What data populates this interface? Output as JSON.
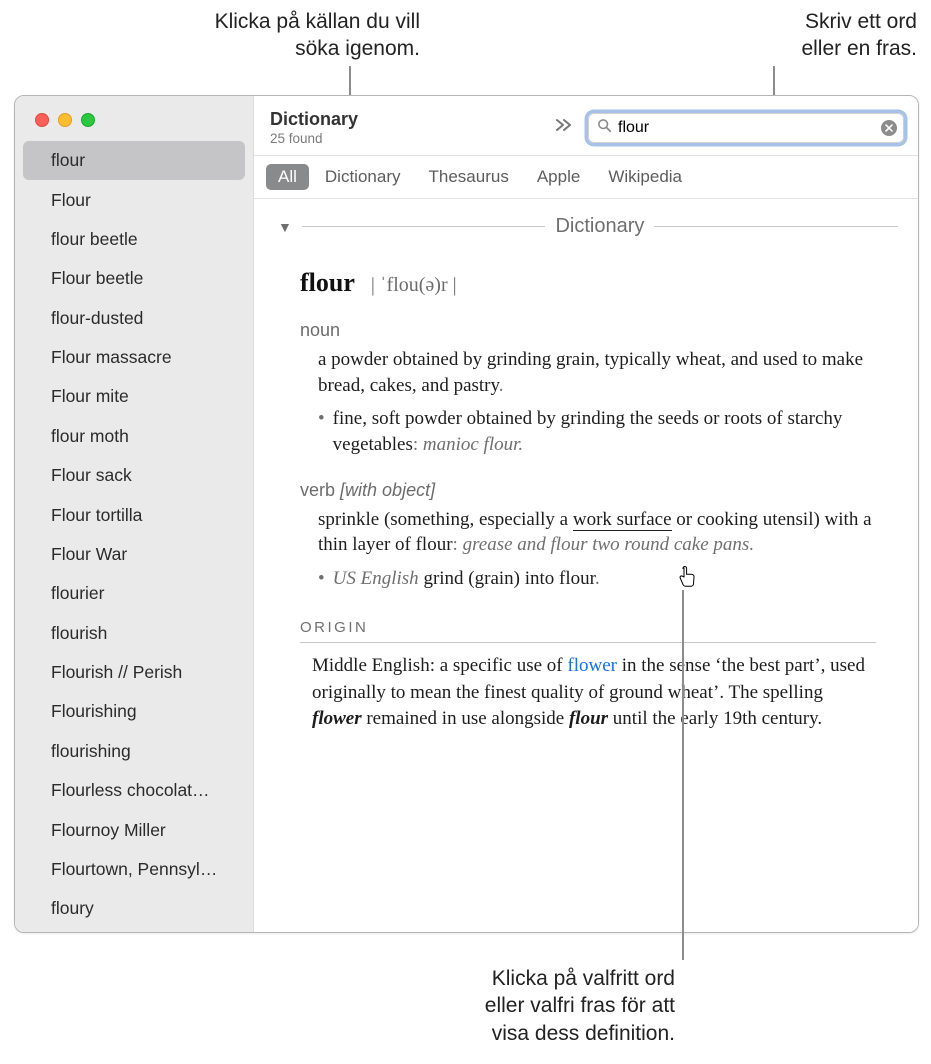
{
  "callouts": {
    "top_left": "Klicka på källan du vill söka igenom.",
    "top_left_1": "Klicka på källan du vill",
    "top_left_2": "söka igenom.",
    "top_right_1": "Skriv ett ord",
    "top_right_2": "eller en fras.",
    "bottom_1": "Klicka på valfritt ord",
    "bottom_2": "eller valfri fras för att",
    "bottom_3": "visa dess definition."
  },
  "header": {
    "title": "Dictionary",
    "subtitle": "25 found"
  },
  "search": {
    "value": "flour"
  },
  "sources": [
    "All",
    "Dictionary",
    "Thesaurus",
    "Apple",
    "Wikipedia"
  ],
  "sources_active_index": 0,
  "sidebar": {
    "items": [
      "flour",
      "Flour",
      "flour beetle",
      "Flour beetle",
      "flour-dusted",
      "Flour massacre",
      "Flour mite",
      "flour moth",
      "Flour sack",
      "Flour tortilla",
      "Flour War",
      "flourier",
      "flourish",
      "Flourish // Perish",
      "Flourishing",
      "flourishing",
      "Flourless chocolat…",
      "Flournoy Miller",
      "Flourtown, Pennsyl…",
      "floury"
    ],
    "selected_index": 0
  },
  "section": {
    "label": "Dictionary"
  },
  "entry": {
    "word": "flour",
    "pronunciation": "| ˈflou(ə)r |",
    "pos_noun": "noun",
    "def_noun": "a powder obtained by grinding grain, typically wheat, and used to make bread, cakes, and pastry",
    "def_noun_period": ".",
    "sub_noun": "fine, soft powder obtained by grinding the seeds or roots of starchy vegetables",
    "sub_noun_example": "manioc flour.",
    "pos_verb": "verb",
    "verb_qual": "[with object]",
    "def_verb_a": "sprinkle (something, especially a ",
    "def_verb_link": "work surface",
    "def_verb_b": " or cooking utensil) with a thin layer of flour",
    "def_verb_example": "grease and flour two round cake pans.",
    "sub_verb_region": "US English",
    "sub_verb_text": " grind (grain) into flour",
    "origin_label": "ORIGIN",
    "origin_a": "Middle English: a specific use of ",
    "origin_link": "flower",
    "origin_b": " in the sense ‘the best part’, used originally to mean the finest quality of ground wheat’. The spelling ",
    "origin_bi1": "flower",
    "origin_c": " remained in use alongside ",
    "origin_bi2": "flour",
    "origin_d": " until the early 19th century."
  }
}
